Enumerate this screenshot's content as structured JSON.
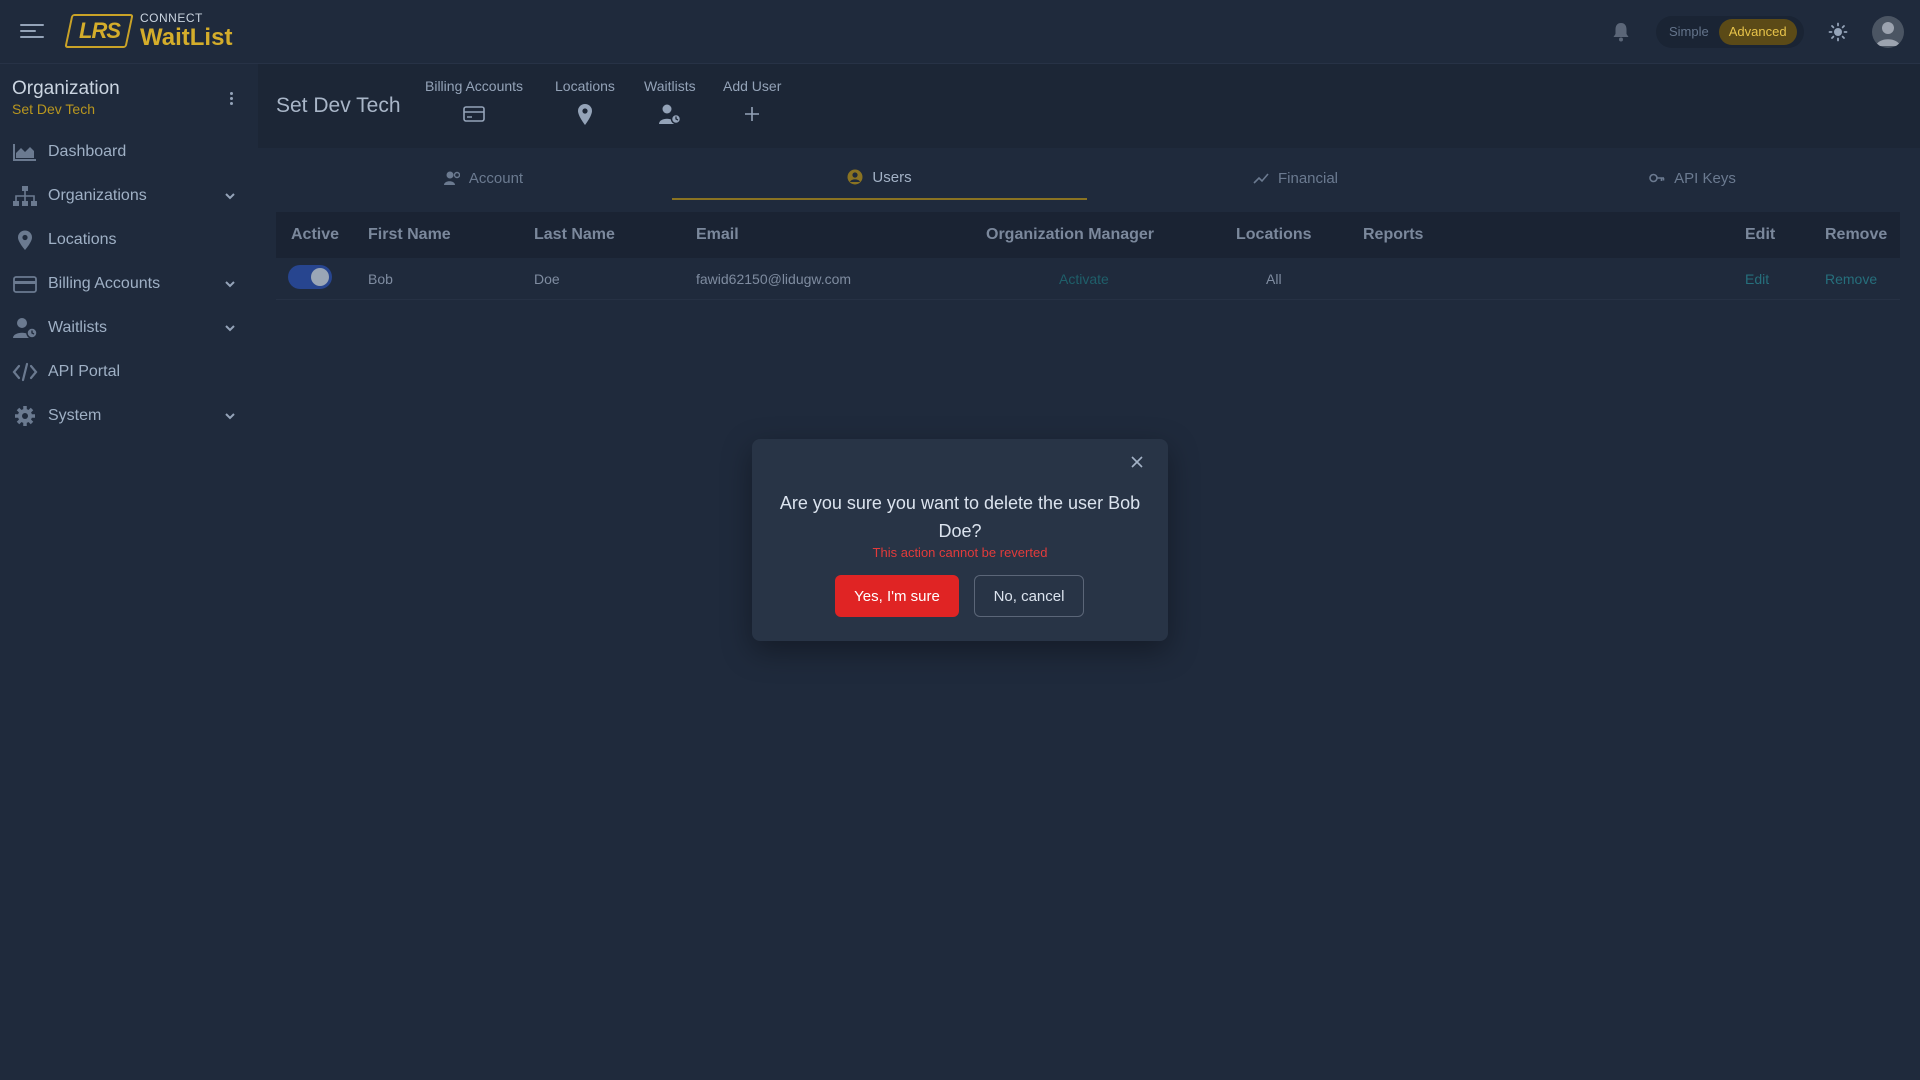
{
  "header": {
    "brand_logo": "LRS",
    "brand_small": "CONNECT",
    "brand_name": "WaitList",
    "mode_simple": "Simple",
    "mode_advanced": "Advanced",
    "active_mode": "Advanced",
    "icons": [
      "menu-icon",
      "bell-icon",
      "sun-icon",
      "user-avatar-icon"
    ]
  },
  "sidebar": {
    "title": "Organization",
    "subtitle": "Set Dev Tech",
    "items": [
      {
        "label": "Dashboard",
        "icon": "chart-area-icon",
        "expandable": false
      },
      {
        "label": "Organizations",
        "icon": "sitemap-icon",
        "expandable": true
      },
      {
        "label": "Locations",
        "icon": "map-pin-icon",
        "expandable": false
      },
      {
        "label": "Billing Accounts",
        "icon": "credit-card-icon",
        "expandable": true
      },
      {
        "label": "Waitlists",
        "icon": "user-clock-icon",
        "expandable": true
      },
      {
        "label": "API Portal",
        "icon": "code-icon",
        "expandable": false
      },
      {
        "label": "System",
        "icon": "gear-icon",
        "expandable": true
      }
    ]
  },
  "org_bar": {
    "name": "Set Dev Tech",
    "quick_links": [
      {
        "label": "Billing Accounts",
        "icon": "credit-card-icon"
      },
      {
        "label": "Locations",
        "icon": "map-pin-icon"
      },
      {
        "label": "Waitlists",
        "icon": "user-clock-icon"
      },
      {
        "label": "Add User",
        "icon": "plus-icon"
      }
    ]
  },
  "tabs": [
    {
      "label": "Account",
      "icon": "user-gear-icon",
      "active": false
    },
    {
      "label": "Users",
      "icon": "user-circle-icon",
      "active": true
    },
    {
      "label": "Financial",
      "icon": "trend-line-icon",
      "active": false
    },
    {
      "label": "API Keys",
      "icon": "key-icon",
      "active": false
    }
  ],
  "table": {
    "columns": [
      "Active",
      "First Name",
      "Last Name",
      "Email",
      "Organization Manager",
      "Locations",
      "Reports",
      "Edit",
      "Remove"
    ],
    "rows": [
      {
        "active": true,
        "first_name": "Bob",
        "last_name": "Doe",
        "email": "fawid62150@lidugw.com",
        "org_manager": "Activate",
        "locations": "All",
        "reports": "",
        "edit": "Edit",
        "remove": "Remove"
      }
    ]
  },
  "dialog": {
    "message": "Are you sure you want to delete the user Bob Doe?",
    "warning": "This action cannot be reverted",
    "confirm_label": "Yes, I'm sure",
    "cancel_label": "No, cancel"
  },
  "colors": {
    "background": "#1f2a3c",
    "accent_gold": "#d4ad2b",
    "danger": "#e02424",
    "link_teal": "#266f7c"
  }
}
